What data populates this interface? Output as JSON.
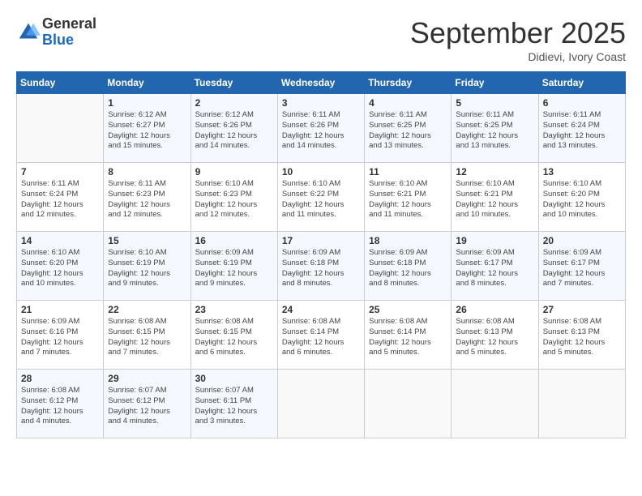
{
  "logo": {
    "general": "General",
    "blue": "Blue"
  },
  "title": "September 2025",
  "location": "Didievi, Ivory Coast",
  "weekdays": [
    "Sunday",
    "Monday",
    "Tuesday",
    "Wednesday",
    "Thursday",
    "Friday",
    "Saturday"
  ],
  "weeks": [
    [
      {
        "day": "",
        "sunrise": "",
        "sunset": "",
        "daylight": ""
      },
      {
        "day": "1",
        "sunrise": "6:12 AM",
        "sunset": "6:27 PM",
        "daylight": "12 hours and 15 minutes."
      },
      {
        "day": "2",
        "sunrise": "6:12 AM",
        "sunset": "6:26 PM",
        "daylight": "12 hours and 14 minutes."
      },
      {
        "day": "3",
        "sunrise": "6:11 AM",
        "sunset": "6:26 PM",
        "daylight": "12 hours and 14 minutes."
      },
      {
        "day": "4",
        "sunrise": "6:11 AM",
        "sunset": "6:25 PM",
        "daylight": "12 hours and 13 minutes."
      },
      {
        "day": "5",
        "sunrise": "6:11 AM",
        "sunset": "6:25 PM",
        "daylight": "12 hours and 13 minutes."
      },
      {
        "day": "6",
        "sunrise": "6:11 AM",
        "sunset": "6:24 PM",
        "daylight": "12 hours and 13 minutes."
      }
    ],
    [
      {
        "day": "7",
        "sunrise": "6:11 AM",
        "sunset": "6:24 PM",
        "daylight": "12 hours and 12 minutes."
      },
      {
        "day": "8",
        "sunrise": "6:11 AM",
        "sunset": "6:23 PM",
        "daylight": "12 hours and 12 minutes."
      },
      {
        "day": "9",
        "sunrise": "6:10 AM",
        "sunset": "6:23 PM",
        "daylight": "12 hours and 12 minutes."
      },
      {
        "day": "10",
        "sunrise": "6:10 AM",
        "sunset": "6:22 PM",
        "daylight": "12 hours and 11 minutes."
      },
      {
        "day": "11",
        "sunrise": "6:10 AM",
        "sunset": "6:21 PM",
        "daylight": "12 hours and 11 minutes."
      },
      {
        "day": "12",
        "sunrise": "6:10 AM",
        "sunset": "6:21 PM",
        "daylight": "12 hours and 10 minutes."
      },
      {
        "day": "13",
        "sunrise": "6:10 AM",
        "sunset": "6:20 PM",
        "daylight": "12 hours and 10 minutes."
      }
    ],
    [
      {
        "day": "14",
        "sunrise": "6:10 AM",
        "sunset": "6:20 PM",
        "daylight": "12 hours and 10 minutes."
      },
      {
        "day": "15",
        "sunrise": "6:10 AM",
        "sunset": "6:19 PM",
        "daylight": "12 hours and 9 minutes."
      },
      {
        "day": "16",
        "sunrise": "6:09 AM",
        "sunset": "6:19 PM",
        "daylight": "12 hours and 9 minutes."
      },
      {
        "day": "17",
        "sunrise": "6:09 AM",
        "sunset": "6:18 PM",
        "daylight": "12 hours and 8 minutes."
      },
      {
        "day": "18",
        "sunrise": "6:09 AM",
        "sunset": "6:18 PM",
        "daylight": "12 hours and 8 minutes."
      },
      {
        "day": "19",
        "sunrise": "6:09 AM",
        "sunset": "6:17 PM",
        "daylight": "12 hours and 8 minutes."
      },
      {
        "day": "20",
        "sunrise": "6:09 AM",
        "sunset": "6:17 PM",
        "daylight": "12 hours and 7 minutes."
      }
    ],
    [
      {
        "day": "21",
        "sunrise": "6:09 AM",
        "sunset": "6:16 PM",
        "daylight": "12 hours and 7 minutes."
      },
      {
        "day": "22",
        "sunrise": "6:08 AM",
        "sunset": "6:15 PM",
        "daylight": "12 hours and 7 minutes."
      },
      {
        "day": "23",
        "sunrise": "6:08 AM",
        "sunset": "6:15 PM",
        "daylight": "12 hours and 6 minutes."
      },
      {
        "day": "24",
        "sunrise": "6:08 AM",
        "sunset": "6:14 PM",
        "daylight": "12 hours and 6 minutes."
      },
      {
        "day": "25",
        "sunrise": "6:08 AM",
        "sunset": "6:14 PM",
        "daylight": "12 hours and 5 minutes."
      },
      {
        "day": "26",
        "sunrise": "6:08 AM",
        "sunset": "6:13 PM",
        "daylight": "12 hours and 5 minutes."
      },
      {
        "day": "27",
        "sunrise": "6:08 AM",
        "sunset": "6:13 PM",
        "daylight": "12 hours and 5 minutes."
      }
    ],
    [
      {
        "day": "28",
        "sunrise": "6:08 AM",
        "sunset": "6:12 PM",
        "daylight": "12 hours and 4 minutes."
      },
      {
        "day": "29",
        "sunrise": "6:07 AM",
        "sunset": "6:12 PM",
        "daylight": "12 hours and 4 minutes."
      },
      {
        "day": "30",
        "sunrise": "6:07 AM",
        "sunset": "6:11 PM",
        "daylight": "12 hours and 3 minutes."
      },
      {
        "day": "",
        "sunrise": "",
        "sunset": "",
        "daylight": ""
      },
      {
        "day": "",
        "sunrise": "",
        "sunset": "",
        "daylight": ""
      },
      {
        "day": "",
        "sunrise": "",
        "sunset": "",
        "daylight": ""
      },
      {
        "day": "",
        "sunrise": "",
        "sunset": "",
        "daylight": ""
      }
    ]
  ]
}
